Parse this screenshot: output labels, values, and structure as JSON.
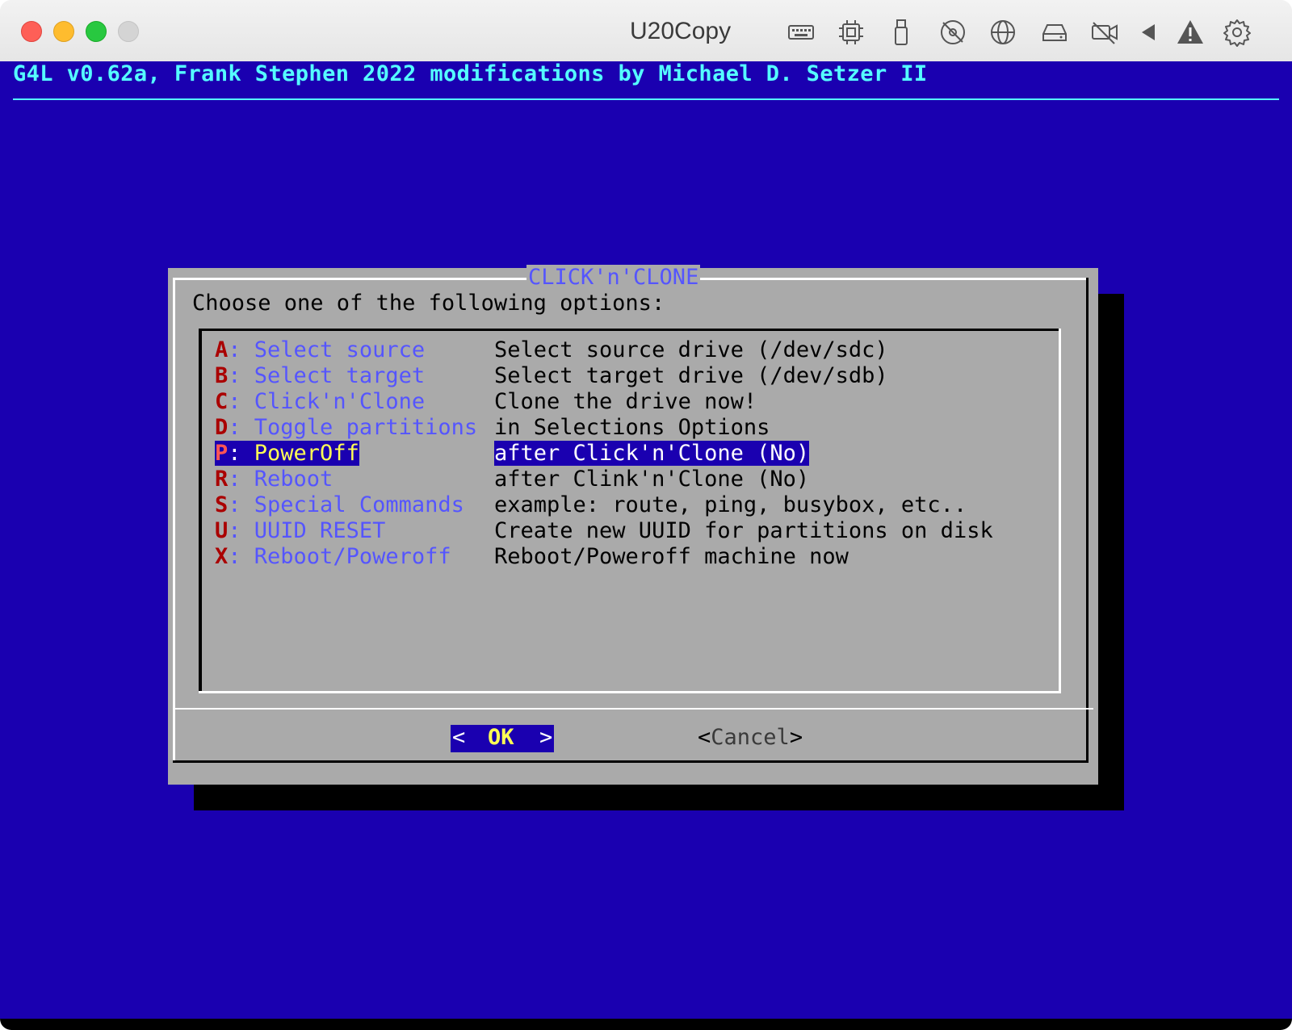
{
  "window": {
    "title": "U20Copy",
    "toolbar_icons": [
      "keyboard-icon",
      "cpu-icon",
      "usb-icon",
      "disc-icon",
      "globe-icon",
      "drive-icon",
      "camera-off-icon",
      "audio-icon",
      "warning-icon",
      "gear-icon"
    ]
  },
  "terminal": {
    "header": "G4L v0.62a, Frank Stephen 2022 modifications by Michael D. Setzer II"
  },
  "dialog": {
    "title": "CLICK'n'CLONE",
    "prompt": "Choose one of the following options:",
    "selected_index": 4,
    "items": [
      {
        "key": "A",
        "label": "Select source",
        "desc": "Select source drive (/dev/sdc)"
      },
      {
        "key": "B",
        "label": "Select target",
        "desc": "Select target drive (/dev/sdb)"
      },
      {
        "key": "C",
        "label": "Click'n'Clone",
        "desc": "Clone the drive now!"
      },
      {
        "key": "D",
        "label": "Toggle partitions",
        "desc": "in Selections Options"
      },
      {
        "key": "P",
        "label": "PowerOff",
        "desc": "after Click'n'Clone (No)"
      },
      {
        "key": "R",
        "label": "Reboot",
        "desc": "after Clink'n'Clone (No)"
      },
      {
        "key": "S",
        "label": "Special Commands",
        "desc": "example: route, ping, busybox, etc.."
      },
      {
        "key": "U",
        "label": "UUID RESET",
        "desc": "Create new UUID for partitions on disk"
      },
      {
        "key": "X",
        "label": "Reboot/Poweroff",
        "desc": "Reboot/Poweroff machine now"
      }
    ],
    "ok_button": {
      "left": "<",
      "label": "OK",
      "right": ">"
    },
    "cancel_button": {
      "left": "<",
      "label": "Cancel",
      "right": ">"
    }
  },
  "colors": {
    "screen_bg": "#1a00b0",
    "dialog_bg": "#aaaaaa",
    "header_text": "#55ffff",
    "hotkey": "#aa0000",
    "item_tag": "#5555ff",
    "selected_tag": "#ffff55"
  }
}
